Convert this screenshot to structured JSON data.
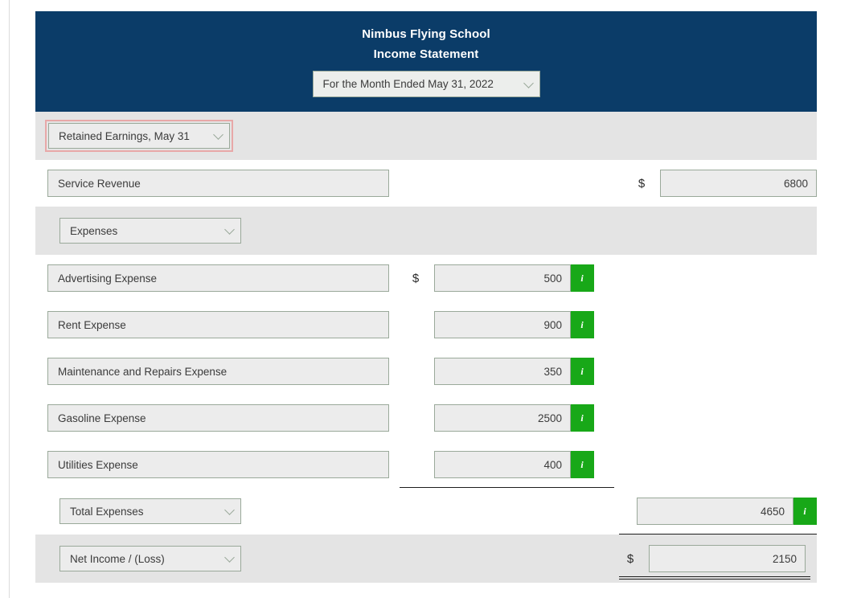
{
  "header": {
    "company": "Nimbus Flying School",
    "statement_title": "Income Statement",
    "period_select": {
      "value": "For the Month Ended May 31, 2022",
      "icon": "chevron-down-icon"
    },
    "background_color": "#0b3c68"
  },
  "accent_colors": {
    "banner_blue": "#0b3c68",
    "info_green": "#18a818",
    "error_red": "#e8a8a8",
    "field_bg": "#ececec",
    "field_border": "#9aa99a",
    "band_bg": "#e4e4e4"
  },
  "rows": [
    {
      "kind": "select_error",
      "name": "retained-earnings-select",
      "label": "Retained Earnings, May 31",
      "icon": "chevron-down-icon",
      "error": true
    },
    {
      "kind": "revenue",
      "name": "service-revenue",
      "label": "Service Revenue",
      "currency": "$",
      "amount": "6800"
    },
    {
      "kind": "section_select",
      "name": "expenses-section-select",
      "label": "Expenses",
      "icon": "chevron-down-icon"
    },
    {
      "kind": "expense",
      "name": "advertising-expense",
      "label": "Advertising Expense",
      "currency": "$",
      "amount": "500",
      "info": "i"
    },
    {
      "kind": "expense",
      "name": "rent-expense",
      "label": "Rent Expense",
      "currency": "",
      "amount": "900",
      "info": "i"
    },
    {
      "kind": "expense",
      "name": "maintenance-and-repairs-expense",
      "label": "Maintenance and Repairs Expense",
      "currency": "",
      "amount": "350",
      "info": "i"
    },
    {
      "kind": "expense",
      "name": "gasoline-expense",
      "label": "Gasoline Expense",
      "currency": "",
      "amount": "2500",
      "info": "i"
    },
    {
      "kind": "expense",
      "name": "utilities-expense",
      "label": "Utilities Expense",
      "currency": "",
      "amount": "400",
      "info": "i"
    },
    {
      "kind": "total",
      "name": "total-expenses",
      "label": "Total Expenses",
      "icon": "chevron-down-icon",
      "currency": "",
      "amount": "4650",
      "info": "i"
    },
    {
      "kind": "net",
      "name": "net-income-loss",
      "label": "Net Income / (Loss)",
      "icon": "chevron-down-icon",
      "currency": "$",
      "amount": "2150"
    }
  ]
}
